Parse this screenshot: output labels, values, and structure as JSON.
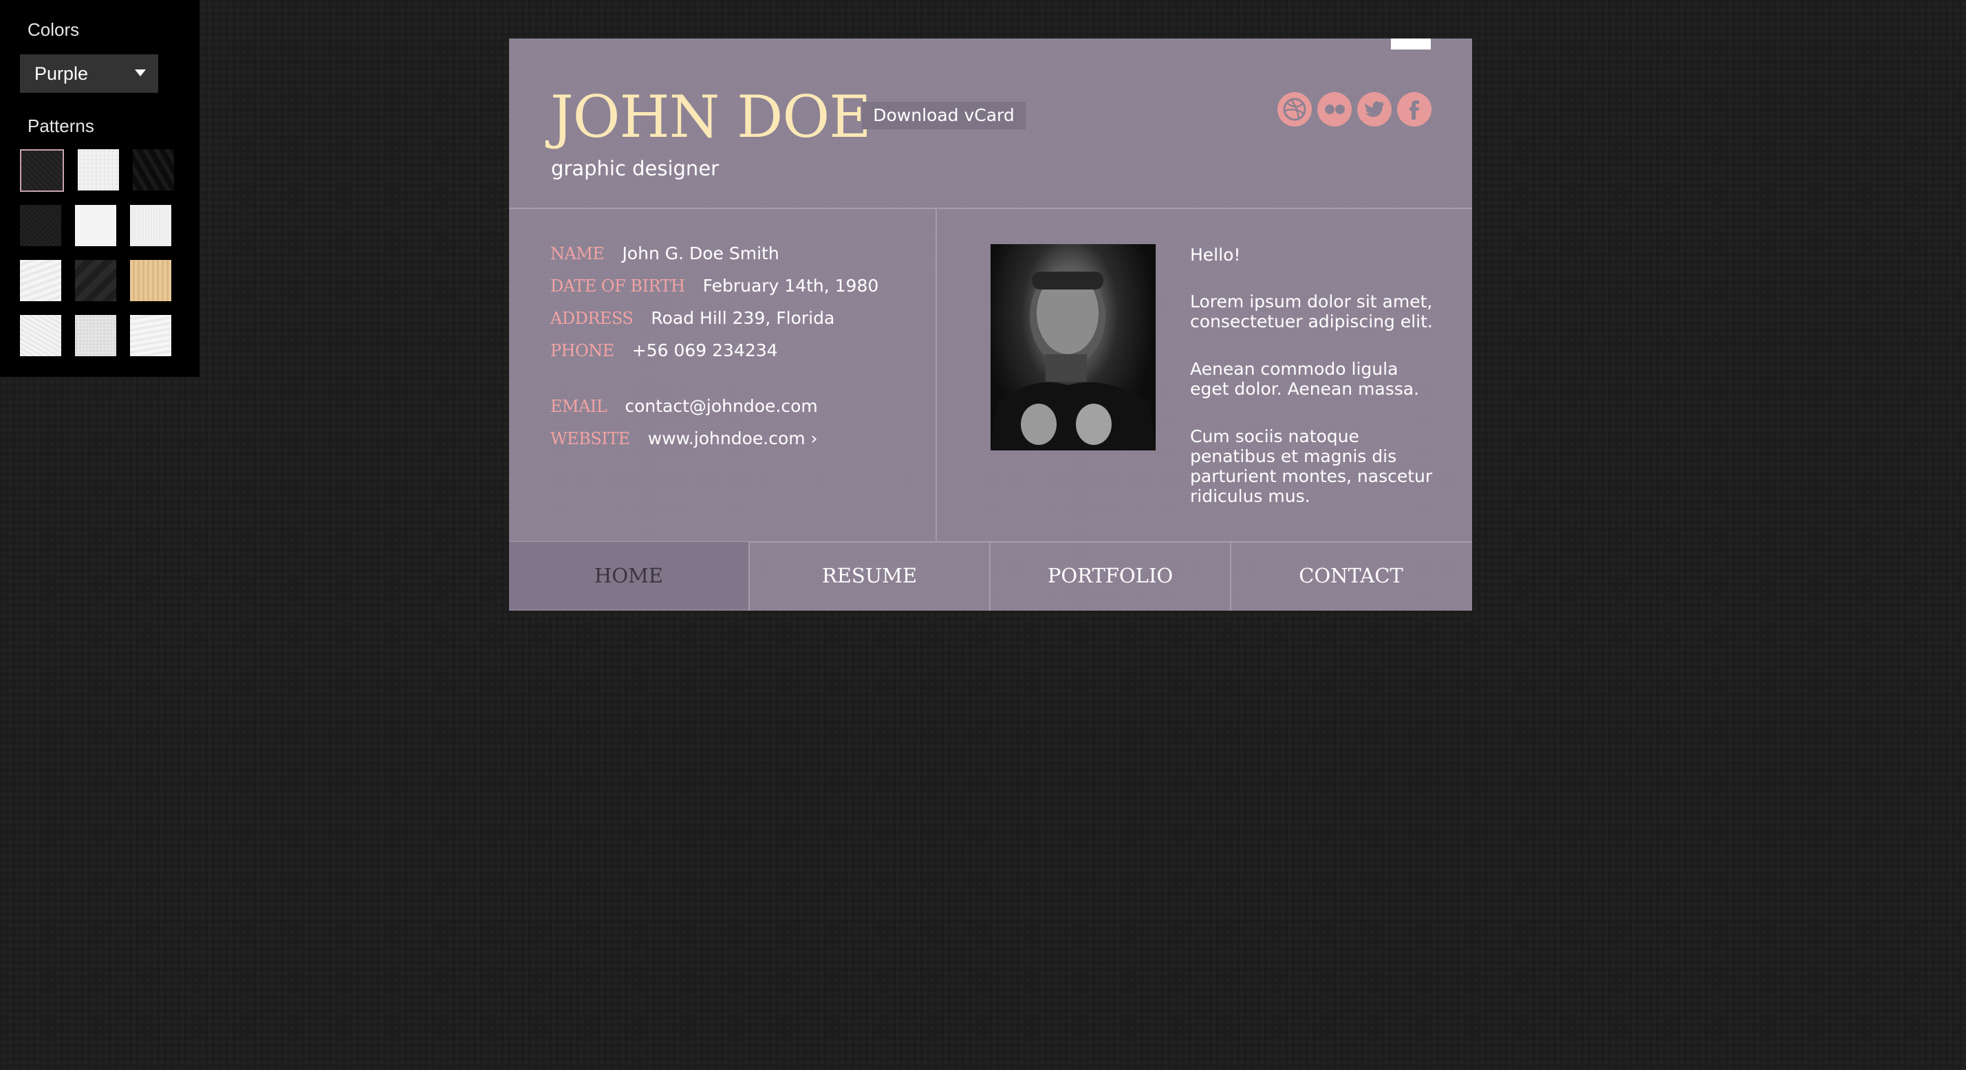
{
  "switcher": {
    "colors_heading": "Colors",
    "color_selected": "Purple",
    "patterns_heading": "Patterns"
  },
  "card": {
    "name": "JOHN DOE",
    "role": "graphic designer",
    "vcard_button": "Download vCard",
    "social": [
      "dribbble-icon",
      "flickr-icon",
      "twitter-icon",
      "facebook-icon"
    ],
    "info": [
      {
        "label": "NAME",
        "value": "John G. Doe Smith"
      },
      {
        "label": "DATE OF BIRTH",
        "value": "February 14th, 1980"
      },
      {
        "label": "ADDRESS",
        "value": "Road Hill 239, Florida"
      },
      {
        "label": "PHONE",
        "value": "+56 069 234234"
      },
      {
        "label": "EMAIL",
        "value": "contact@johndoe.com"
      },
      {
        "label": "WEBSITE",
        "value": "www.johndoe.com ›"
      }
    ],
    "about": [
      "Hello!",
      "Lorem ipsum dolor sit amet, consectetuer adipiscing elit.",
      "Aenean commodo ligula eget dolor. Aenean massa.",
      "Cum sociis natoque penatibus et magnis dis parturient montes, nascetur ridiculus mus."
    ]
  },
  "nav": {
    "items": [
      "HOME",
      "RESUME",
      "PORTFOLIO",
      "CONTACT"
    ],
    "active": "HOME"
  },
  "colors": {
    "card_bg": "#8b8193",
    "name_color": "#fbe8b6",
    "label_color": "#f2a3a3",
    "social_color": "#e79a9a",
    "page_bg": "#1c1c1c"
  }
}
